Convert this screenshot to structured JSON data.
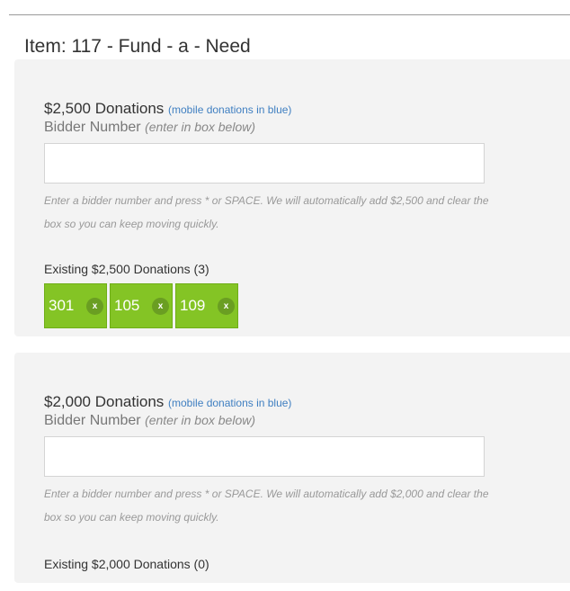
{
  "page": {
    "title": "Item: 117 - Fund - a - Need"
  },
  "sections": [
    {
      "heading": "$2,500 Donations",
      "mobile_note": "(mobile donations in blue)",
      "bidder_label": "Bidder Number",
      "bidder_hint": "(enter in box below)",
      "input_value": "",
      "help_text": "Enter a bidder number and press * or SPACE. We will automatically add $2,500 and clear the box so you can keep moving quickly.",
      "existing_label": "Existing $2,500 Donations (3)",
      "donations": [
        {
          "number": "301",
          "remove_label": "x"
        },
        {
          "number": "105",
          "remove_label": "x"
        },
        {
          "number": "109",
          "remove_label": "x"
        }
      ]
    },
    {
      "heading": "$2,000 Donations",
      "mobile_note": "(mobile donations in blue)",
      "bidder_label": "Bidder Number",
      "bidder_hint": "(enter in box below)",
      "input_value": "",
      "help_text": "Enter a bidder number and press * or SPACE. We will automatically add $2,000 and clear the box so you can keep moving quickly.",
      "existing_label": "Existing $2,000 Donations (0)",
      "donations": []
    }
  ],
  "colors": {
    "chip_green": "#84c425",
    "chip_remove": "#6a9e22",
    "mobile_blue": "#3f7fc1",
    "panel_bg": "#f3f3f3"
  }
}
